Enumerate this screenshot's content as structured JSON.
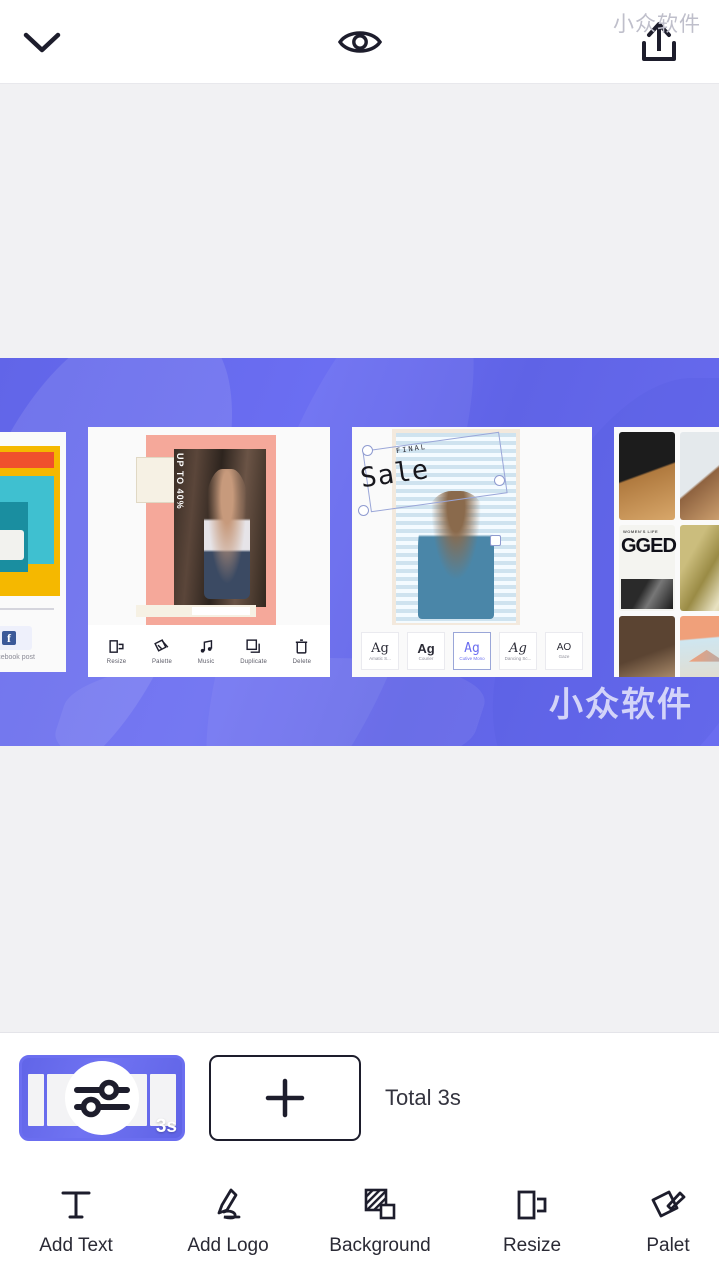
{
  "app": {
    "watermark": "小众软件",
    "accent_purple": "#6b6ef0",
    "ink": "#1d1d2c",
    "surface": "#f1f1f3"
  },
  "topbar": {
    "collapse": {
      "name": "chevron-down-icon",
      "label": "Collapse"
    },
    "preview": {
      "name": "eye-icon",
      "label": "Preview"
    },
    "share": {
      "name": "share-upload-icon",
      "label": "Export"
    }
  },
  "canvas": {
    "cards": [
      {
        "id": "facebook-post",
        "type": "template-preview",
        "caption": "Facebook post",
        "brand_icon": "f"
      },
      {
        "id": "up-to-40",
        "type": "selected-item-card",
        "headline": "UP TO 40%",
        "toolbar": [
          {
            "label": "Resize",
            "icon": "resize-icon"
          },
          {
            "label": "Palette",
            "icon": "palette-icon"
          },
          {
            "label": "Music",
            "icon": "music-note-icon"
          },
          {
            "label": "Duplicate",
            "icon": "duplicate-icon"
          },
          {
            "label": "Delete",
            "icon": "trash-icon"
          }
        ]
      },
      {
        "id": "final-sale",
        "type": "text-edit-card",
        "kicker": "FINAL",
        "headline": "Sale",
        "fonts": [
          {
            "sample": "Ag",
            "name": "Amatic S...",
            "selected": false
          },
          {
            "sample": "Ag",
            "name": "Courier",
            "selected": false
          },
          {
            "sample": "Ag",
            "name": "Cutive Mono",
            "selected": true
          },
          {
            "sample": "Ag",
            "name": "Dancing Sc...",
            "selected": false
          },
          {
            "sample": "AO",
            "name": "Gaze",
            "selected": false
          }
        ]
      },
      {
        "id": "collage",
        "type": "collage-card",
        "kicker": "WOMEN'S LIFE",
        "headline": "GGED"
      }
    ]
  },
  "timeline": {
    "clip": {
      "duration_label": "3s",
      "overlay_icon": "adjust-sliders-icon"
    },
    "add_button": {
      "label": "+",
      "name": "add-clip-button"
    },
    "total_label": "Total 3s"
  },
  "bottom_toolbar": {
    "items": [
      {
        "label": "Add Text",
        "icon": "text-icon"
      },
      {
        "label": "Add Logo",
        "icon": "pen-signature-icon"
      },
      {
        "label": "Background",
        "icon": "background-pattern-icon"
      },
      {
        "label": "Resize",
        "icon": "resize-frames-icon"
      },
      {
        "label": "Palet",
        "icon": "palette-brush-icon"
      }
    ]
  }
}
